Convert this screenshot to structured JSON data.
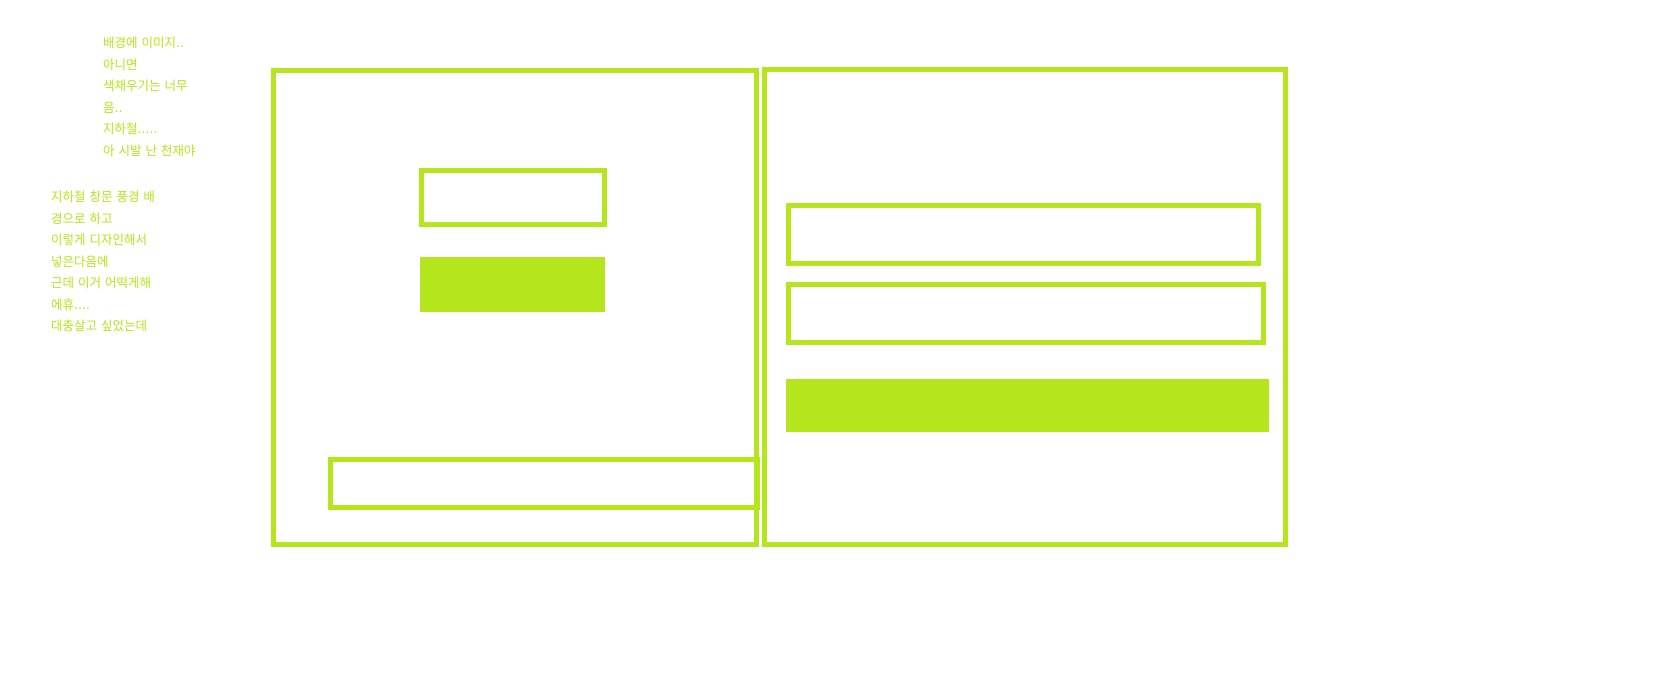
{
  "colors": {
    "accent": "#b5e61d",
    "background": "#ffffff"
  },
  "notes": {
    "top": [
      "배경에 이미지..",
      "아니면",
      "색채우기는 너무",
      "음..",
      "지하철.....",
      "아 시발 난 천재야"
    ],
    "bottom": [
      "지하철 창문 풍경 배",
      "경으로 하고",
      "이렇게 디자인해서",
      "넣은다음에",
      "근데 이거 어떡게해",
      "에휴....",
      "대충살고 싶었는데"
    ]
  }
}
